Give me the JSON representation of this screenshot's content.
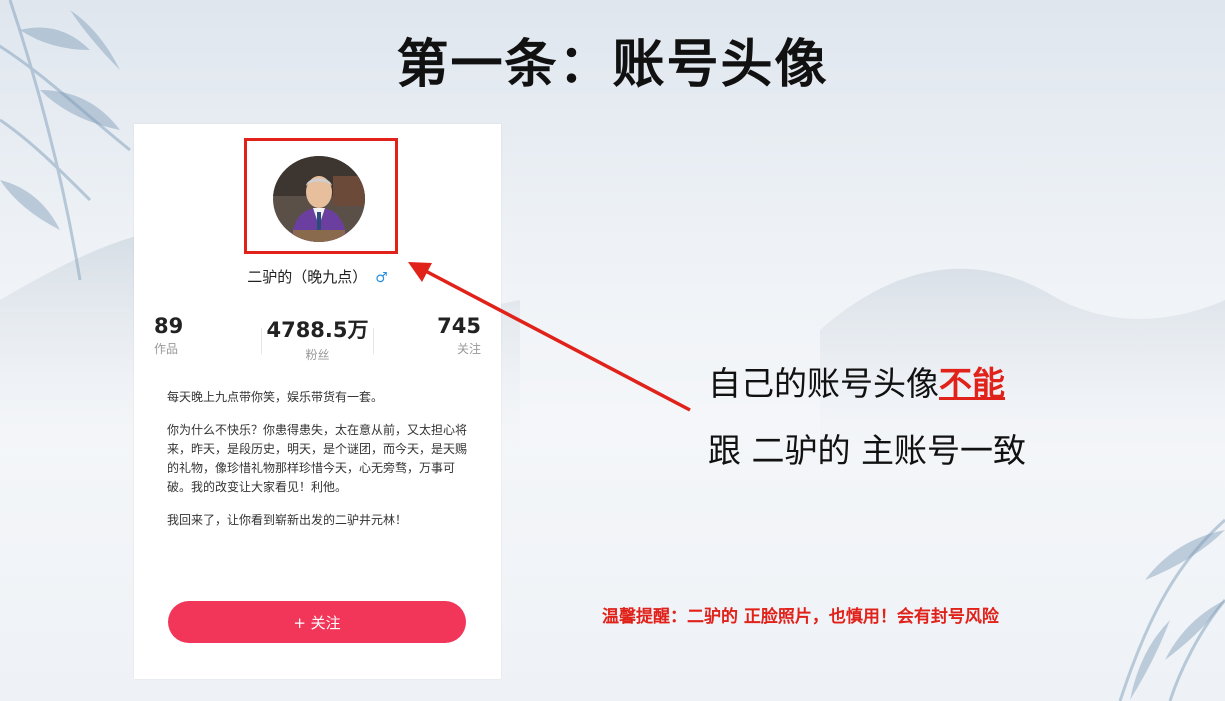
{
  "slide": {
    "title": "第一条：账号头像"
  },
  "profile": {
    "username": "二驴的（晚九点）",
    "gender_icon": "male-symbol-icon",
    "stats": [
      {
        "value": "89",
        "label": "作品"
      },
      {
        "value": "4788.5万",
        "label": "粉丝"
      },
      {
        "value": "745",
        "label": "关注"
      }
    ],
    "bio": [
      "每天晚上九点带你笑，娱乐带货有一套。",
      "你为什么不快乐？你患得患失，太在意从前，又太担心将来，昨天，是段历史，明天，是个谜团，而今天，是天赐的礼物，像珍惜礼物那样珍惜今天，心无旁骛，万事可破。我的改变让大家看见！利他。",
      "我回来了，让你看到崭新出发的二驴井元林！"
    ],
    "follow_label": "+ 关注"
  },
  "annotation": {
    "line1_prefix": "自己的账号头像",
    "line1_emphasis": "不能",
    "line2": "跟 二驴的 主账号一致",
    "warning": "温馨提醒：二驴的 正脸照片，也慎用！会有封号风险",
    "highlight_color": "#e0221a",
    "button_color": "#f2365a"
  }
}
